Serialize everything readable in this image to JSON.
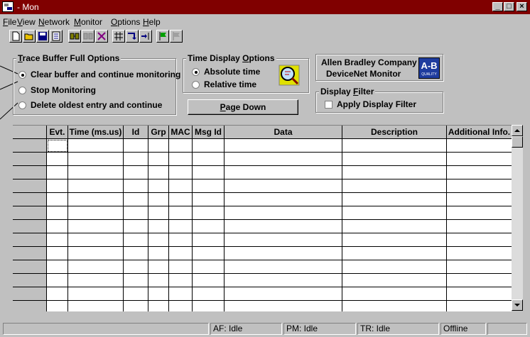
{
  "window": {
    "title": "- Mon",
    "controls": [
      "_",
      "□",
      "×"
    ]
  },
  "menu": [
    {
      "label": "File",
      "u": "F",
      "rest": "ile"
    },
    {
      "label": "View",
      "u": "V",
      "rest": "iew"
    },
    {
      "label": "Network",
      "u": "N",
      "rest": "etwork"
    },
    {
      "label": "Monitor",
      "u": "M",
      "rest": "onitor"
    },
    {
      "label": "Options",
      "u": "O",
      "rest": "ptions"
    },
    {
      "label": "Help",
      "u": "H",
      "rest": "elp"
    }
  ],
  "toolbar": {
    "icons": [
      "new-icon",
      "open-icon",
      "save-icon",
      "properties-icon",
      "connect-icon",
      "disconnect-icon",
      "delete-icon",
      "filter-icon",
      "step-icon",
      "step-into-icon",
      "start-flag-icon",
      "stop-flag-icon"
    ]
  },
  "trace": {
    "legend_u": "T",
    "legend_rest": "race Buffer Full Options",
    "options": [
      {
        "label": "Clear buffer and continue monitoring",
        "selected": true
      },
      {
        "label": "Stop Monitoring",
        "selected": false
      },
      {
        "label": "Delete oldest entry and continue",
        "selected": false
      }
    ]
  },
  "time": {
    "legend_pre": "Time Display ",
    "legend_u": "O",
    "legend_rest": "ptions",
    "options": [
      {
        "label": "Absolute time",
        "selected": true
      },
      {
        "label": "Relative time",
        "selected": false
      }
    ]
  },
  "company": {
    "line1": "Allen Bradley Company",
    "line2": "DeviceNet Monitor",
    "logo_text": "A-B",
    "logo_sub": "QUALITY"
  },
  "page_down": {
    "u": "P",
    "rest": "age Down"
  },
  "display_filter": {
    "legend_pre": "Display ",
    "legend_u": "F",
    "legend_rest": "ilter",
    "checkbox_label": "Apply Display Filter",
    "checked": false
  },
  "table": {
    "columns": [
      "Evt.",
      "Time (ms.us)",
      "Id",
      "Grp",
      "MAC",
      "Msg Id",
      "Data",
      "Description",
      "Additional Info."
    ],
    "rows": 13
  },
  "status": {
    "af": "AF: Idle",
    "pm": "PM: Idle",
    "tr": "TR: Idle",
    "mode": "Offline"
  },
  "colors": {
    "titlebar": "#800000",
    "face": "#c0c0c0",
    "logo": "#1e3c9e"
  }
}
